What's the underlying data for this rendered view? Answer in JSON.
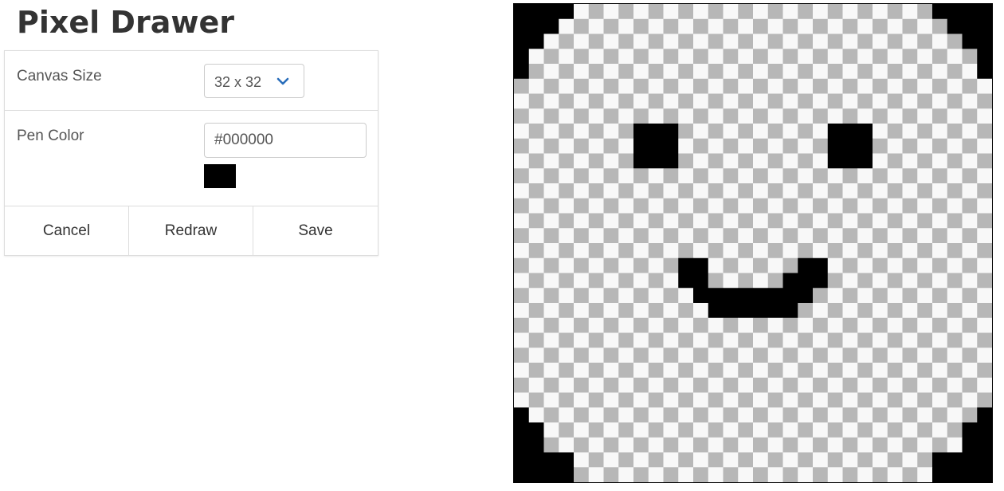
{
  "app": {
    "title": "Pixel Drawer"
  },
  "controls": {
    "canvas_size_label": "Canvas Size",
    "canvas_size_value": "32 x 32",
    "pen_color_label": "Pen Color",
    "pen_color_value": "#000000",
    "pen_color_swatch": "#000000",
    "cancel_label": "Cancel",
    "redraw_label": "Redraw",
    "save_label": "Save"
  },
  "canvas": {
    "grid_size": 32,
    "checker_light": "#f8f8f8",
    "checker_dark": "#b7b7b7",
    "pixel_color": "#000000",
    "filled_pixels": [
      [
        0,
        0
      ],
      [
        1,
        0
      ],
      [
        2,
        0
      ],
      [
        3,
        0
      ],
      [
        0,
        1
      ],
      [
        1,
        1
      ],
      [
        2,
        1
      ],
      [
        0,
        2
      ],
      [
        1,
        2
      ],
      [
        0,
        3
      ],
      [
        0,
        4
      ],
      [
        28,
        0
      ],
      [
        29,
        0
      ],
      [
        30,
        0
      ],
      [
        31,
        0
      ],
      [
        29,
        1
      ],
      [
        30,
        1
      ],
      [
        31,
        1
      ],
      [
        30,
        2
      ],
      [
        31,
        2
      ],
      [
        31,
        3
      ],
      [
        31,
        4
      ],
      [
        0,
        27
      ],
      [
        0,
        28
      ],
      [
        1,
        28
      ],
      [
        0,
        29
      ],
      [
        1,
        29
      ],
      [
        0,
        30
      ],
      [
        1,
        30
      ],
      [
        2,
        30
      ],
      [
        3,
        30
      ],
      [
        0,
        31
      ],
      [
        1,
        31
      ],
      [
        2,
        31
      ],
      [
        3,
        31
      ],
      [
        31,
        27
      ],
      [
        30,
        28
      ],
      [
        31,
        28
      ],
      [
        30,
        29
      ],
      [
        31,
        29
      ],
      [
        28,
        30
      ],
      [
        29,
        30
      ],
      [
        30,
        30
      ],
      [
        31,
        30
      ],
      [
        28,
        31
      ],
      [
        29,
        31
      ],
      [
        30,
        31
      ],
      [
        31,
        31
      ],
      [
        8,
        8
      ],
      [
        9,
        8
      ],
      [
        10,
        8
      ],
      [
        8,
        9
      ],
      [
        9,
        9
      ],
      [
        10,
        9
      ],
      [
        8,
        10
      ],
      [
        9,
        10
      ],
      [
        10,
        10
      ],
      [
        21,
        8
      ],
      [
        22,
        8
      ],
      [
        23,
        8
      ],
      [
        21,
        9
      ],
      [
        22,
        9
      ],
      [
        23,
        9
      ],
      [
        21,
        10
      ],
      [
        22,
        10
      ],
      [
        23,
        10
      ],
      [
        11,
        17
      ],
      [
        12,
        17
      ],
      [
        19,
        17
      ],
      [
        20,
        17
      ],
      [
        11,
        18
      ],
      [
        12,
        18
      ],
      [
        18,
        18
      ],
      [
        19,
        18
      ],
      [
        20,
        18
      ],
      [
        12,
        19
      ],
      [
        13,
        19
      ],
      [
        14,
        19
      ],
      [
        15,
        19
      ],
      [
        16,
        19
      ],
      [
        17,
        19
      ],
      [
        18,
        19
      ],
      [
        19,
        19
      ],
      [
        13,
        20
      ],
      [
        14,
        20
      ],
      [
        15,
        20
      ],
      [
        16,
        20
      ],
      [
        17,
        20
      ],
      [
        18,
        20
      ]
    ]
  }
}
